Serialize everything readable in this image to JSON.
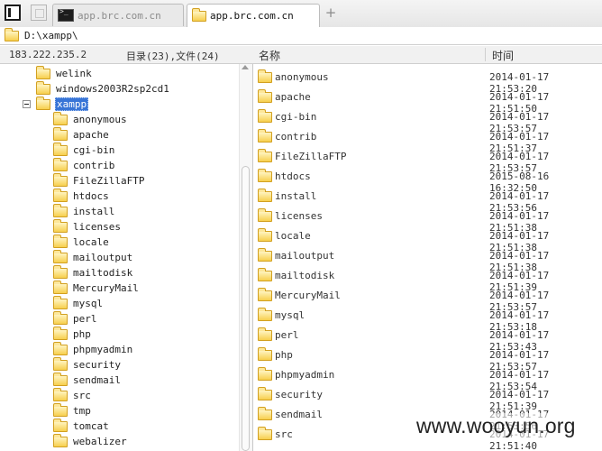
{
  "tabs": [
    {
      "label": "app.brc.com.cn",
      "icon": "terminal-icon",
      "active": false
    },
    {
      "label": "app.brc.com.cn",
      "icon": "folder-icon",
      "active": true
    }
  ],
  "new_tab": "+",
  "address": {
    "path": "D:\\xampp\\"
  },
  "status": {
    "ip": "183.222.235.2",
    "counts": "目录(23),文件(24)"
  },
  "columns": {
    "name": "名称",
    "time": "时间"
  },
  "tree": {
    "items": [
      {
        "label": "welink"
      },
      {
        "label": "windows2003R2sp2cd1"
      },
      {
        "label": "xampp",
        "selected": true,
        "expanded": true
      },
      {
        "label": "anonymous"
      },
      {
        "label": "apache"
      },
      {
        "label": "cgi-bin"
      },
      {
        "label": "contrib"
      },
      {
        "label": "FileZillaFTP"
      },
      {
        "label": "htdocs"
      },
      {
        "label": "install"
      },
      {
        "label": "licenses"
      },
      {
        "label": "locale"
      },
      {
        "label": "mailoutput"
      },
      {
        "label": "mailtodisk"
      },
      {
        "label": "MercuryMail"
      },
      {
        "label": "mysql"
      },
      {
        "label": "perl"
      },
      {
        "label": "php"
      },
      {
        "label": "phpmyadmin"
      },
      {
        "label": "security"
      },
      {
        "label": "sendmail"
      },
      {
        "label": "src"
      },
      {
        "label": "tmp"
      },
      {
        "label": "tomcat"
      },
      {
        "label": "webalizer"
      }
    ]
  },
  "files": [
    {
      "name": "anonymous",
      "time": "2014-01-17 21:53:20"
    },
    {
      "name": "apache",
      "time": "2014-01-17 21:51:50"
    },
    {
      "name": "cgi-bin",
      "time": "2014-01-17 21:53:57"
    },
    {
      "name": "contrib",
      "time": "2014-01-17 21:51:37"
    },
    {
      "name": "FileZillaFTP",
      "time": "2014-01-17 21:53:57"
    },
    {
      "name": "htdocs",
      "time": "2015-08-16 16:32:50"
    },
    {
      "name": "install",
      "time": "2014-01-17 21:53:56"
    },
    {
      "name": "licenses",
      "time": "2014-01-17 21:51:38"
    },
    {
      "name": "locale",
      "time": "2014-01-17 21:51:38"
    },
    {
      "name": "mailoutput",
      "time": "2014-01-17 21:51:38"
    },
    {
      "name": "mailtodisk",
      "time": "2014-01-17 21:51:39"
    },
    {
      "name": "MercuryMail",
      "time": "2014-01-17 21:53:57"
    },
    {
      "name": "mysql",
      "time": "2014-01-17 21:53:18"
    },
    {
      "name": "perl",
      "time": "2014-01-17 21:53:43"
    },
    {
      "name": "php",
      "time": "2014-01-17 21:53:57"
    },
    {
      "name": "phpmyadmin",
      "time": "2014-01-17 21:53:54"
    },
    {
      "name": "security",
      "time": "2014-01-17 21:51:39"
    },
    {
      "name": "sendmail",
      "time": "2014-01-17 21:53:56"
    },
    {
      "name": "src",
      "time": "2014-01-17 21:51:40"
    }
  ],
  "watermark": "www.wooyun.org"
}
